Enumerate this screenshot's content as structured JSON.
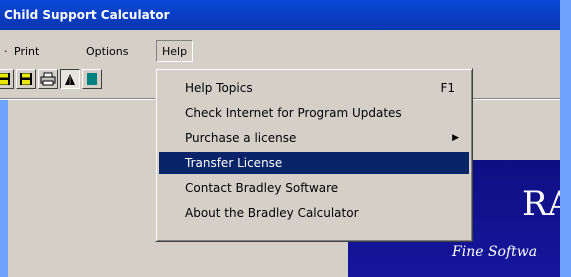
{
  "window": {
    "title": "Child Support Calculator"
  },
  "menubar": {
    "items": [
      {
        "label": "Print"
      },
      {
        "label": "Options"
      },
      {
        "label": "Help"
      }
    ]
  },
  "toolbar": {
    "buttons": [
      {
        "icon": "save-icon"
      },
      {
        "icon": "save-as-icon"
      },
      {
        "icon": "print-icon"
      },
      {
        "icon": "chart-icon",
        "pressed": true
      }
    ]
  },
  "help_menu": {
    "items": [
      {
        "label": "Help Topics",
        "shortcut": "F1"
      },
      {
        "label": "Check Internet for Program Updates"
      },
      {
        "label": "Purchase a license",
        "submenu": true
      },
      {
        "label": "Transfer License",
        "selected": true
      },
      {
        "label": "Contact Bradley Software"
      },
      {
        "label": "About the Bradley Calculator"
      }
    ]
  },
  "banner": {
    "text_large": "RA",
    "text_tagline": "Fine Softwa"
  },
  "colors": {
    "titlebar": "#0a3cc0",
    "desktop": "#6ea3ff",
    "selection": "#0a246a",
    "banner": "#15169c"
  }
}
